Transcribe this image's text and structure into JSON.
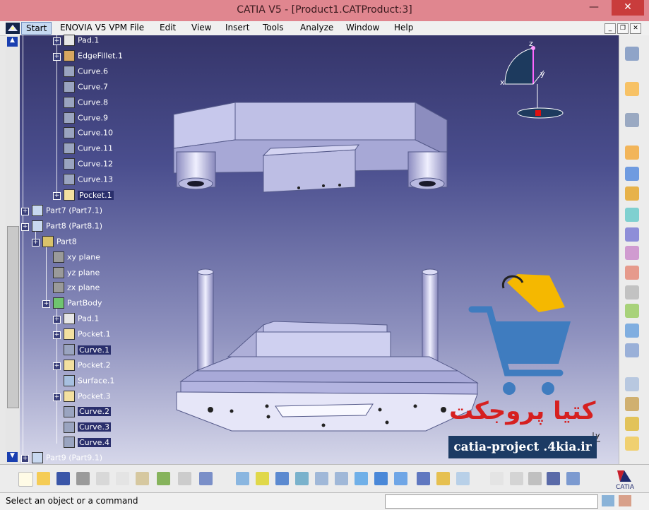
{
  "window": {
    "title": "CATIA V5 - [Product1.CATProduct:3]",
    "minimize": "—",
    "close": "✕"
  },
  "menu": {
    "start": "Start",
    "items": [
      "ENOVIA V5 VPM",
      "File",
      "Edit",
      "View",
      "Insert",
      "Tools",
      "Analyze",
      "Window",
      "Help"
    ]
  },
  "tree": {
    "nodes": [
      {
        "label": "Pad.1",
        "icon": "pad-icon"
      },
      {
        "label": "EdgeFillet.1",
        "icon": "fillet-icon"
      },
      {
        "label": "Curve.6",
        "icon": "curve-icon"
      },
      {
        "label": "Curve.7",
        "icon": "curve-icon"
      },
      {
        "label": "Curve.8",
        "icon": "curve-icon"
      },
      {
        "label": "Curve.9",
        "icon": "curve-icon"
      },
      {
        "label": "Curve.10",
        "icon": "curve-icon"
      },
      {
        "label": "Curve.11",
        "icon": "curve-icon"
      },
      {
        "label": "Curve.12",
        "icon": "curve-icon"
      },
      {
        "label": "Curve.13",
        "icon": "curve-icon"
      },
      {
        "label": "Pocket.1",
        "icon": "pocket-icon"
      },
      {
        "label": "Part7 (Part7.1)",
        "icon": "product-icon"
      },
      {
        "label": "Part8 (Part8.1)",
        "icon": "product-icon"
      },
      {
        "label": "Part8",
        "icon": "part-icon"
      },
      {
        "label": "xy plane",
        "icon": "plane-icon"
      },
      {
        "label": "yz plane",
        "icon": "plane-icon"
      },
      {
        "label": "zx plane",
        "icon": "plane-icon"
      },
      {
        "label": "PartBody",
        "icon": "body-icon"
      },
      {
        "label": "Pad.1",
        "icon": "pad-icon"
      },
      {
        "label": "Pocket.1",
        "icon": "pocket-icon"
      },
      {
        "label": "Curve.1",
        "icon": "curve-icon"
      },
      {
        "label": "Pocket.2",
        "icon": "pocket-icon"
      },
      {
        "label": "Surface.1",
        "icon": "surface-icon"
      },
      {
        "label": "Pocket.3",
        "icon": "pocket-icon"
      },
      {
        "label": "Curve.2",
        "icon": "curve-icon"
      },
      {
        "label": "Curve.3",
        "icon": "curve-icon"
      },
      {
        "label": "Curve.4",
        "icon": "curve-icon"
      },
      {
        "label": "Part9 (Part9.1)",
        "icon": "product-icon"
      }
    ]
  },
  "compass": {
    "x": "x",
    "y": "y",
    "z": "z"
  },
  "axis_corner": {
    "y": "y"
  },
  "watermark": {
    "persian": "کتیا پروجکت",
    "site": "catia-project .4kia.ir"
  },
  "status": {
    "prompt": "Select an object or a command"
  },
  "colors": {
    "titlebar": "#e0868f",
    "viewport_top": "#35356a",
    "viewport_bottom": "#d6d7ea",
    "watermark_red": "#d62020",
    "cart_blue": "#3f7cbf",
    "bag_yellow": "#f5b800"
  }
}
